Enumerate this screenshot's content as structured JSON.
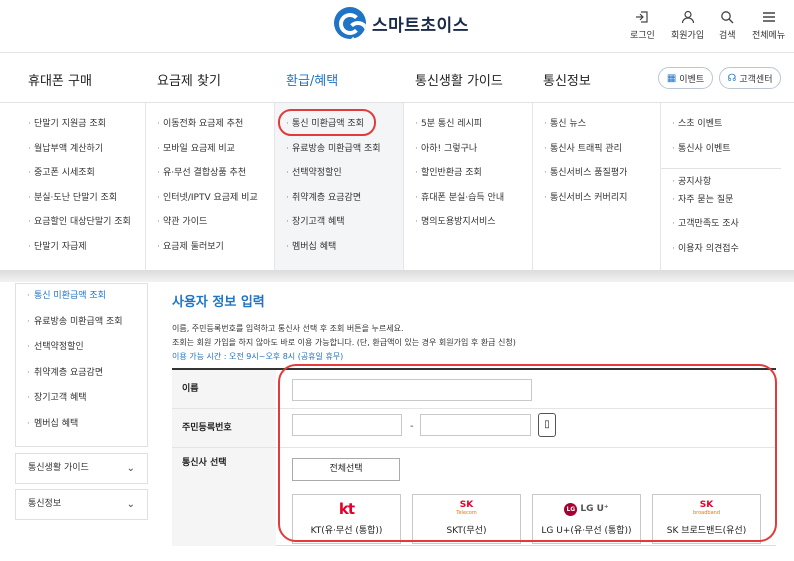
{
  "header": {
    "logo_text": "스마트초이스",
    "utils": [
      {
        "label": "로그인",
        "icon": "login-icon"
      },
      {
        "label": "회원가입",
        "icon": "user-icon"
      },
      {
        "label": "검색",
        "icon": "search-icon"
      },
      {
        "label": "전체메뉴",
        "icon": "menu-icon"
      }
    ]
  },
  "gnb": {
    "items": [
      "휴대폰 구매",
      "요금제 찾기",
      "환급/혜택",
      "통신생활 가이드",
      "통신정보"
    ],
    "active_index": 2,
    "event_label": "이벤트",
    "support_label": "고객센터"
  },
  "mega": {
    "col1": [
      "단말기 지원금 조회",
      "월납부액 계산하기",
      "중고폰 시세조회",
      "분실·도난 단말기 조회",
      "요금할인 대상단말기 조회",
      "단말기 자급제"
    ],
    "col2": [
      "이동전화 요금제 추천",
      "모바일 요금제 비교",
      "유·무선 결합상품 추천",
      "인터넷/IPTV 요금제 비교",
      "약관 가이드",
      "요금제 둘러보기"
    ],
    "col3": [
      "통신 미환급액 조회",
      "유료방송 미환급액 조회",
      "선택약정할인",
      "취약계층 요금감면",
      "장기고객 혜택",
      "멤버십 혜택"
    ],
    "col4": [
      "5분 통신 레시피",
      "아하! 그렇구나",
      "할인반환금 조회",
      "휴대폰 분실·습득 안내",
      "명의도용방지서비스"
    ],
    "col5": [
      "통신 뉴스",
      "통신사 트래픽 관리",
      "통신서비스 품질평가",
      "통신서비스 커버리지"
    ],
    "col6": [
      "스초 이벤트",
      "통신사 이벤트",
      "공지사항",
      "자주 묻는 질문",
      "고객만족도 조사",
      "이용자 의견접수"
    ]
  },
  "sidebar": {
    "items": [
      "통신 미환급액 조회",
      "유료방송 미환급액 조회",
      "선택약정할인",
      "취약계층 요금감면",
      "장기고객 혜택",
      "멤버십 혜택"
    ],
    "active_index": 0,
    "folds": [
      "통신생활 가이드",
      "통신정보"
    ]
  },
  "content": {
    "title": "사용자 정보 입력",
    "desc1": "이름, 주민등록번호를 입력하고 통신사 선택 후 조회 버튼을 누르세요.",
    "desc2": "조회는 회원 가입을 하지 않아도 바로 이용 가능합니다. (단, 환급액이 있는 경우 회원가입 후 환급 신청)",
    "desc3": "이용 가능 시간 : 오전 9시~오후 8시 (공휴일 휴무)",
    "name_label": "이름",
    "ssn_label": "주민등록번호",
    "carrier_label": "통신사 선택",
    "ssn_dash": "-",
    "keypad_icon": "keypad-icon",
    "select_all": "전체선택",
    "carriers": [
      {
        "brand": "kt",
        "name": "KT(유·무선 (통합))"
      },
      {
        "brand": "SK",
        "brand_sub": "Telecom",
        "name": "SKT(무선)"
      },
      {
        "brand": "LG U⁺",
        "name": "LG U+(유·무선 (통합))"
      },
      {
        "brand": "SK",
        "brand_sub": "broadband",
        "name": "SK 브로드밴드(유선)"
      }
    ]
  },
  "colors": {
    "accent": "#1f74c6",
    "highlight": "#e23b3b"
  }
}
